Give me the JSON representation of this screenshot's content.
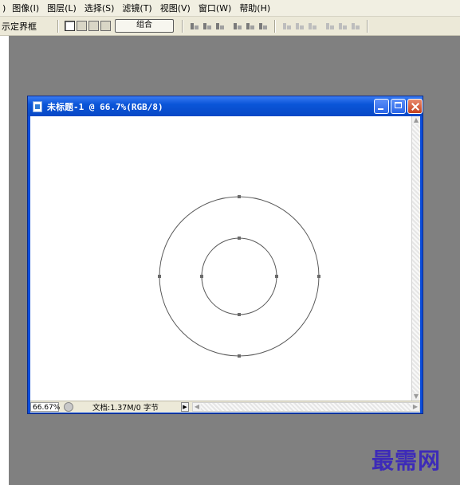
{
  "menu": {
    "paren": ")",
    "items": [
      "图像(I)",
      "图层(L)",
      "选择(S)",
      "滤镜(T)",
      "视图(V)",
      "窗口(W)",
      "帮助(H)"
    ]
  },
  "options_bar": {
    "bounding_box_label": "示定界框",
    "combine_label": "组合",
    "shape_mode_icons": [
      "add-to-shape-area-icon",
      "subtract-from-shape-area-icon",
      "intersect-shape-areas-icon",
      "exclude-overlapping-shape-areas-icon"
    ],
    "align_icons": [
      "align-top-edges-icon",
      "align-vertical-centers-icon",
      "align-bottom-edges-icon",
      "align-left-edges-icon",
      "align-horizontal-centers-icon",
      "align-right-edges-icon"
    ],
    "distribute_icons": [
      "distribute-top-edges-icon",
      "distribute-vertical-centers-icon",
      "distribute-bottom-edges-icon",
      "distribute-left-edges-icon",
      "distribute-horizontal-centers-icon",
      "distribute-right-edges-icon"
    ]
  },
  "document": {
    "title": "未标题-1 @ 66.7%(RGB/8)",
    "zoom": "66.67%",
    "doc_size": "文档:1.37M/0 字节"
  },
  "canvas": {
    "shapes": [
      {
        "name": "outer-circle-path",
        "type": "ellipse"
      },
      {
        "name": "inner-circle-path",
        "type": "ellipse"
      }
    ],
    "path_color": "#5a5a5a"
  },
  "colors": {
    "workspace": "#808080",
    "titlebar": "#0a55d8",
    "watermark": "#3d2bb8"
  },
  "watermark": "最需网"
}
